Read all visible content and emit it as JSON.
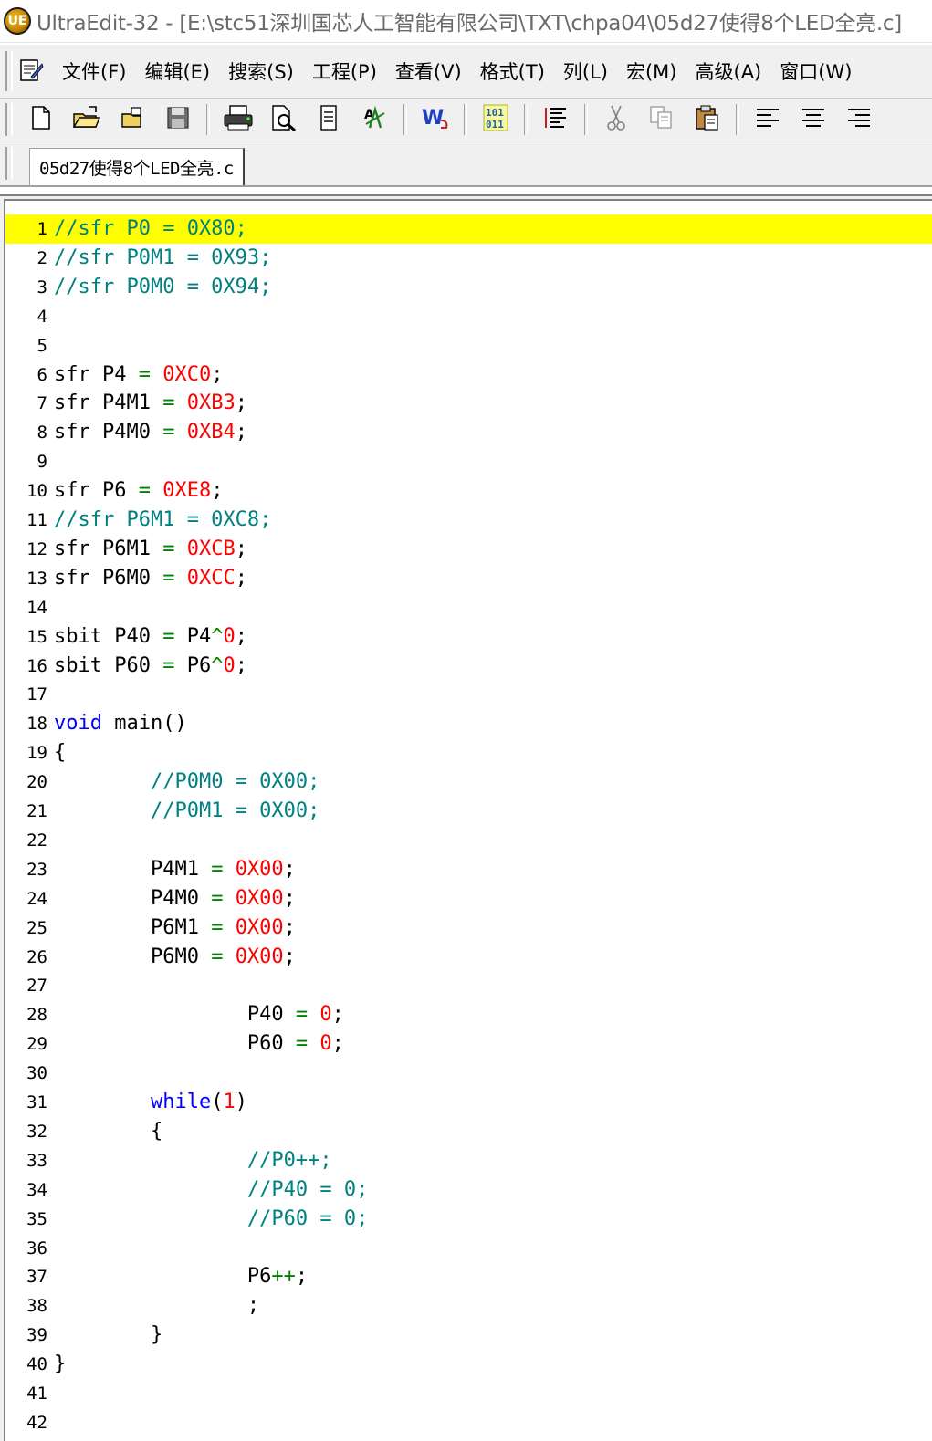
{
  "window": {
    "title": "UltraEdit-32 - [E:\\stc51深圳国芯人工智能有限公司\\TXT\\chpa04\\05d27使得8个LED全亮.c]",
    "app_icon": "ultraedit-logo-icon"
  },
  "menu": {
    "items": [
      {
        "label": "文件(F)"
      },
      {
        "label": "编辑(E)"
      },
      {
        "label": "搜索(S)"
      },
      {
        "label": "工程(P)"
      },
      {
        "label": "查看(V)"
      },
      {
        "label": "格式(T)"
      },
      {
        "label": "列(L)"
      },
      {
        "label": "宏(M)"
      },
      {
        "label": "高级(A)"
      },
      {
        "label": "窗口(W)"
      }
    ]
  },
  "toolbar": {
    "buttons": [
      {
        "icon": "new-file-icon"
      },
      {
        "icon": "open-file-icon"
      },
      {
        "icon": "close-file-icon"
      },
      {
        "icon": "save-icon"
      },
      {
        "icon": "print-icon"
      },
      {
        "icon": "print-preview-icon"
      },
      {
        "icon": "page-setup-icon"
      },
      {
        "icon": "spell-check-icon"
      },
      {
        "icon": "word-wrap-icon"
      },
      {
        "icon": "hex-mode-icon"
      },
      {
        "icon": "line-number-icon"
      },
      {
        "icon": "cut-icon"
      },
      {
        "icon": "copy-icon"
      },
      {
        "icon": "paste-icon"
      },
      {
        "icon": "align-left-icon"
      },
      {
        "icon": "align-center-icon"
      },
      {
        "icon": "align-right-icon"
      }
    ]
  },
  "tabs": [
    {
      "label": "05d27使得8个LED全亮.c"
    }
  ],
  "editor": {
    "current_line": 1,
    "colors": {
      "comment": "#008080",
      "number": "#ff0000",
      "keyword": "#0000ff",
      "operator": "#008000",
      "highlight": "#ffff00"
    },
    "lines": [
      {
        "n": "1",
        "tokens": [
          {
            "t": "//sfr P0 = 0X80;",
            "c": "comment"
          }
        ]
      },
      {
        "n": "2",
        "tokens": [
          {
            "t": "//sfr P0M1 = 0X93;",
            "c": "comment"
          }
        ]
      },
      {
        "n": "3",
        "tokens": [
          {
            "t": "//sfr P0M0 = 0X94;",
            "c": "comment"
          }
        ]
      },
      {
        "n": "4",
        "tokens": []
      },
      {
        "n": "5",
        "tokens": []
      },
      {
        "n": "6",
        "tokens": [
          {
            "t": "sfr P4 ",
            "c": "plain"
          },
          {
            "t": "=",
            "c": "op"
          },
          {
            "t": " ",
            "c": "plain"
          },
          {
            "t": "0XC0",
            "c": "num"
          },
          {
            "t": ";",
            "c": "plain"
          }
        ]
      },
      {
        "n": "7",
        "tokens": [
          {
            "t": "sfr P4M1 ",
            "c": "plain"
          },
          {
            "t": "=",
            "c": "op"
          },
          {
            "t": " ",
            "c": "plain"
          },
          {
            "t": "0XB3",
            "c": "num"
          },
          {
            "t": ";",
            "c": "plain"
          }
        ]
      },
      {
        "n": "8",
        "tokens": [
          {
            "t": "sfr P4M0 ",
            "c": "plain"
          },
          {
            "t": "=",
            "c": "op"
          },
          {
            "t": " ",
            "c": "plain"
          },
          {
            "t": "0XB4",
            "c": "num"
          },
          {
            "t": ";",
            "c": "plain"
          }
        ]
      },
      {
        "n": "9",
        "tokens": []
      },
      {
        "n": "10",
        "tokens": [
          {
            "t": "sfr P6 ",
            "c": "plain"
          },
          {
            "t": "=",
            "c": "op"
          },
          {
            "t": " ",
            "c": "plain"
          },
          {
            "t": "0XE8",
            "c": "num"
          },
          {
            "t": ";",
            "c": "plain"
          }
        ]
      },
      {
        "n": "11",
        "tokens": [
          {
            "t": "//sfr P6M1 = 0XC8;",
            "c": "comment"
          }
        ]
      },
      {
        "n": "12",
        "tokens": [
          {
            "t": "sfr P6M1 ",
            "c": "plain"
          },
          {
            "t": "=",
            "c": "op"
          },
          {
            "t": " ",
            "c": "plain"
          },
          {
            "t": "0XCB",
            "c": "num"
          },
          {
            "t": ";",
            "c": "plain"
          }
        ]
      },
      {
        "n": "13",
        "tokens": [
          {
            "t": "sfr P6M0 ",
            "c": "plain"
          },
          {
            "t": "=",
            "c": "op"
          },
          {
            "t": " ",
            "c": "plain"
          },
          {
            "t": "0XCC",
            "c": "num"
          },
          {
            "t": ";",
            "c": "plain"
          }
        ]
      },
      {
        "n": "14",
        "tokens": []
      },
      {
        "n": "15",
        "tokens": [
          {
            "t": "sbit P40 ",
            "c": "plain"
          },
          {
            "t": "=",
            "c": "op"
          },
          {
            "t": " P4",
            "c": "plain"
          },
          {
            "t": "^",
            "c": "op"
          },
          {
            "t": "0",
            "c": "num"
          },
          {
            "t": ";",
            "c": "plain"
          }
        ]
      },
      {
        "n": "16",
        "tokens": [
          {
            "t": "sbit P60 ",
            "c": "plain"
          },
          {
            "t": "=",
            "c": "op"
          },
          {
            "t": " P6",
            "c": "plain"
          },
          {
            "t": "^",
            "c": "op"
          },
          {
            "t": "0",
            "c": "num"
          },
          {
            "t": ";",
            "c": "plain"
          }
        ]
      },
      {
        "n": "17",
        "tokens": []
      },
      {
        "n": "18",
        "tokens": [
          {
            "t": "void",
            "c": "kw"
          },
          {
            "t": " main()",
            "c": "plain"
          }
        ]
      },
      {
        "n": "19",
        "tokens": [
          {
            "t": "{",
            "c": "plain"
          }
        ]
      },
      {
        "n": "20",
        "tokens": [
          {
            "t": "        ",
            "c": "plain"
          },
          {
            "t": "//P0M0 = 0X00;",
            "c": "comment"
          }
        ]
      },
      {
        "n": "21",
        "tokens": [
          {
            "t": "        ",
            "c": "plain"
          },
          {
            "t": "//P0M1 = 0X00;",
            "c": "comment"
          }
        ]
      },
      {
        "n": "22",
        "tokens": []
      },
      {
        "n": "23",
        "tokens": [
          {
            "t": "        P4M1 ",
            "c": "plain"
          },
          {
            "t": "=",
            "c": "op"
          },
          {
            "t": " ",
            "c": "plain"
          },
          {
            "t": "0X00",
            "c": "num"
          },
          {
            "t": ";",
            "c": "plain"
          }
        ]
      },
      {
        "n": "24",
        "tokens": [
          {
            "t": "        P4M0 ",
            "c": "plain"
          },
          {
            "t": "=",
            "c": "op"
          },
          {
            "t": " ",
            "c": "plain"
          },
          {
            "t": "0X00",
            "c": "num"
          },
          {
            "t": ";",
            "c": "plain"
          }
        ]
      },
      {
        "n": "25",
        "tokens": [
          {
            "t": "        P6M1 ",
            "c": "plain"
          },
          {
            "t": "=",
            "c": "op"
          },
          {
            "t": " ",
            "c": "plain"
          },
          {
            "t": "0X00",
            "c": "num"
          },
          {
            "t": ";",
            "c": "plain"
          }
        ]
      },
      {
        "n": "26",
        "tokens": [
          {
            "t": "        P6M0 ",
            "c": "plain"
          },
          {
            "t": "=",
            "c": "op"
          },
          {
            "t": " ",
            "c": "plain"
          },
          {
            "t": "0X00",
            "c": "num"
          },
          {
            "t": ";",
            "c": "plain"
          }
        ]
      },
      {
        "n": "27",
        "tokens": []
      },
      {
        "n": "28",
        "tokens": [
          {
            "t": "                P40 ",
            "c": "plain"
          },
          {
            "t": "=",
            "c": "op"
          },
          {
            "t": " ",
            "c": "plain"
          },
          {
            "t": "0",
            "c": "num"
          },
          {
            "t": ";",
            "c": "plain"
          }
        ]
      },
      {
        "n": "29",
        "tokens": [
          {
            "t": "                P60 ",
            "c": "plain"
          },
          {
            "t": "=",
            "c": "op"
          },
          {
            "t": " ",
            "c": "plain"
          },
          {
            "t": "0",
            "c": "num"
          },
          {
            "t": ";",
            "c": "plain"
          }
        ]
      },
      {
        "n": "30",
        "tokens": []
      },
      {
        "n": "31",
        "tokens": [
          {
            "t": "        ",
            "c": "plain"
          },
          {
            "t": "while",
            "c": "kw"
          },
          {
            "t": "(",
            "c": "plain"
          },
          {
            "t": "1",
            "c": "num"
          },
          {
            "t": ")",
            "c": "plain"
          }
        ]
      },
      {
        "n": "32",
        "tokens": [
          {
            "t": "        {",
            "c": "plain"
          }
        ]
      },
      {
        "n": "33",
        "tokens": [
          {
            "t": "                ",
            "c": "plain"
          },
          {
            "t": "//P0++;",
            "c": "comment"
          }
        ]
      },
      {
        "n": "34",
        "tokens": [
          {
            "t": "                ",
            "c": "plain"
          },
          {
            "t": "//P40 = 0;",
            "c": "comment"
          }
        ]
      },
      {
        "n": "35",
        "tokens": [
          {
            "t": "                ",
            "c": "plain"
          },
          {
            "t": "//P60 = 0;",
            "c": "comment"
          }
        ]
      },
      {
        "n": "36",
        "tokens": []
      },
      {
        "n": "37",
        "tokens": [
          {
            "t": "                P6",
            "c": "plain"
          },
          {
            "t": "++",
            "c": "op"
          },
          {
            "t": ";",
            "c": "plain"
          }
        ]
      },
      {
        "n": "38",
        "tokens": [
          {
            "t": "                ;",
            "c": "plain"
          }
        ]
      },
      {
        "n": "39",
        "tokens": [
          {
            "t": "        }",
            "c": "plain"
          }
        ]
      },
      {
        "n": "40",
        "tokens": [
          {
            "t": "}",
            "c": "plain"
          }
        ]
      },
      {
        "n": "41",
        "tokens": []
      },
      {
        "n": "42",
        "tokens": []
      }
    ]
  }
}
